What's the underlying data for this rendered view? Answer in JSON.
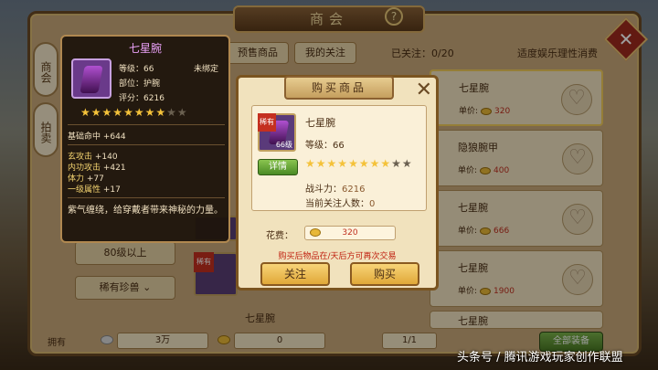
{
  "shop": {
    "title": "商会",
    "help_symbol": "?",
    "close_symbol": "✕",
    "side_tabs": [
      "商会",
      "拍卖"
    ],
    "tabs": [
      "预售商品",
      "我的关注"
    ],
    "followed": "已关注：0/20",
    "leisure": "适度娱乐理性消费",
    "filters": [
      "80级以上",
      "稀有珍兽"
    ],
    "filter_arrow": "⌄",
    "items": [
      {
        "name": "七星腕",
        "price_label": "单价:",
        "price": "320"
      },
      {
        "name": "隐狼腕甲",
        "price_label": "单价:",
        "price": "400"
      },
      {
        "name": "七星腕",
        "price_label": "单价:",
        "price": "666"
      },
      {
        "name": "七星腕",
        "price_label": "单价:",
        "price": "1900"
      },
      {
        "name": "七星腕",
        "price_label": "",
        "price": ""
      }
    ],
    "grid": [
      {
        "rare": "",
        "level": "",
        "name": ""
      },
      {
        "rare": "稀有",
        "level": "66",
        "name": ""
      },
      {
        "rare": "",
        "level": "",
        "name": "七星腕"
      }
    ],
    "bottom": {
      "own_label": "拥有",
      "silver": "3万",
      "gold": "0",
      "page": "1/1",
      "all_equip": "全部装备"
    }
  },
  "tooltip": {
    "name": "七星腕",
    "level_label": "等级：",
    "level": "66",
    "bind": "未绑定",
    "slot_label": "部位：",
    "slot": "护腕",
    "score_label": "评分：",
    "score": "6216",
    "stars_on": 8,
    "stars_total": 10,
    "base_stat": "基础命中",
    "base_val": "+644",
    "stats": [
      {
        "label": "玄攻击",
        "val": "+140"
      },
      {
        "label": "内功攻击",
        "val": "+421"
      },
      {
        "label": "体力",
        "val": "+77"
      },
      {
        "label": "一级属性",
        "val": "+17"
      }
    ],
    "desc": "紫气缠绕，给穿戴者带来神秘的力量。"
  },
  "dialog": {
    "title": "购买商品",
    "close": "✕",
    "rare": "稀有",
    "icon_level": "66级",
    "detail": "详情",
    "name": "七星腕",
    "level_label": "等级：",
    "level": "66",
    "stars_on": 8,
    "stars_total": 10,
    "power_label": "战斗力：",
    "power": "6216",
    "followers_label": "当前关注人数：",
    "followers": "0",
    "cost_label": "花费：",
    "cost": "320",
    "notice": "购买后物品在/天后方可再次交易",
    "follow_btn": "关注",
    "buy_btn": "购买"
  },
  "watermark": "头条号 / 腾讯游戏玩家创作联盟",
  "colors": {
    "rare_red": "#c43020",
    "star_gold": "#f4c23a",
    "tooltip_name": "#e9a0f6"
  }
}
